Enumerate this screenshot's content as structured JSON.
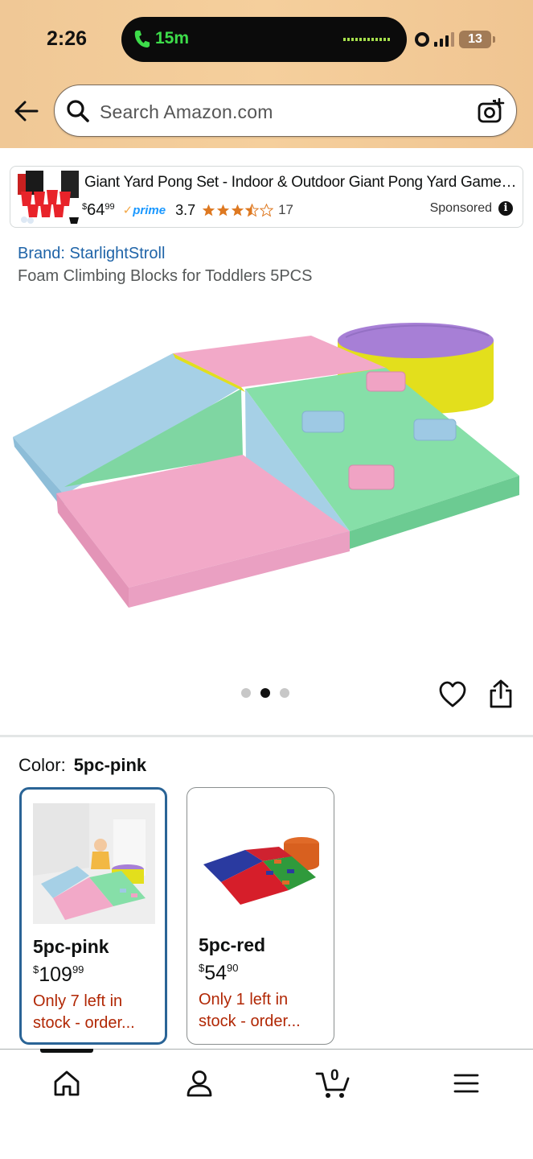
{
  "status_bar": {
    "time": "2:26",
    "call_timer": "15m",
    "battery": "13"
  },
  "header": {
    "search_placeholder": "Search Amazon.com"
  },
  "ad": {
    "title": "Giant Yard Pong Set - Indoor & Outdoor Giant Pong Yard Game -...",
    "price_currency": "$",
    "price_whole": "64",
    "price_fraction": "99",
    "prime_label": "prime",
    "rating": "3.7",
    "stars": 3.5,
    "review_count": "17",
    "sponsored_label": "Sponsored"
  },
  "product": {
    "brand": "Brand: StarlightStroll",
    "title": "Foam Climbing Blocks for Toddlers 5PCS",
    "image_count": 3,
    "active_image": 1
  },
  "color_selector": {
    "label": "Color:",
    "selected_value": "5pc-pink",
    "options": [
      {
        "name": "5pc-pink",
        "currency": "$",
        "price_whole": "109",
        "price_fraction": "99",
        "stock": "Only 7 left in stock - order..."
      },
      {
        "name": "5pc-red",
        "currency": "$",
        "price_whole": "54",
        "price_fraction": "90",
        "stock": "Only 1 left in stock - order..."
      }
    ]
  },
  "bottom_nav": {
    "items": [
      "home-icon",
      "account-icon",
      "cart-icon",
      "menu-icon"
    ],
    "cart_count": "0"
  },
  "colors": {
    "header_bg": "#f0c896",
    "link_blue": "#1f64a8",
    "stock_red": "#b12704",
    "selected_border": "#2a6496",
    "call_green": "#3ddc4a"
  }
}
